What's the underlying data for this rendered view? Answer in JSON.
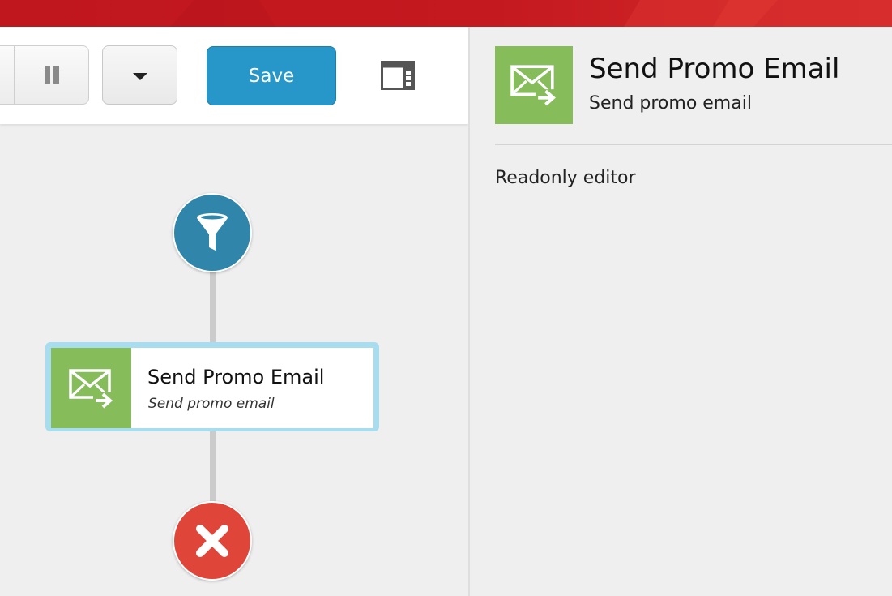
{
  "header": {
    "accent": "#c4191f"
  },
  "toolbar": {
    "pause_icon": "pause-icon",
    "dropdown_icon": "caret-down-icon",
    "save_label": "Save",
    "save_color": "#2796c8",
    "panel_toggle_icon": "panel-layout-icon"
  },
  "workflow": {
    "start_node": {
      "icon": "funnel-icon",
      "color": "#2f86aa"
    },
    "action": {
      "title": "Send Promo Email",
      "subtitle": "Send promo email",
      "icon": "email-send-icon",
      "icon_color": "#86bc5a",
      "selected_border": "#a8dcef"
    },
    "end_node": {
      "icon": "close-icon",
      "color": "#e0453a"
    }
  },
  "details": {
    "icon": "email-send-icon",
    "title": "Send Promo Email",
    "subtitle": "Send promo email",
    "body_text": "Readonly editor"
  }
}
